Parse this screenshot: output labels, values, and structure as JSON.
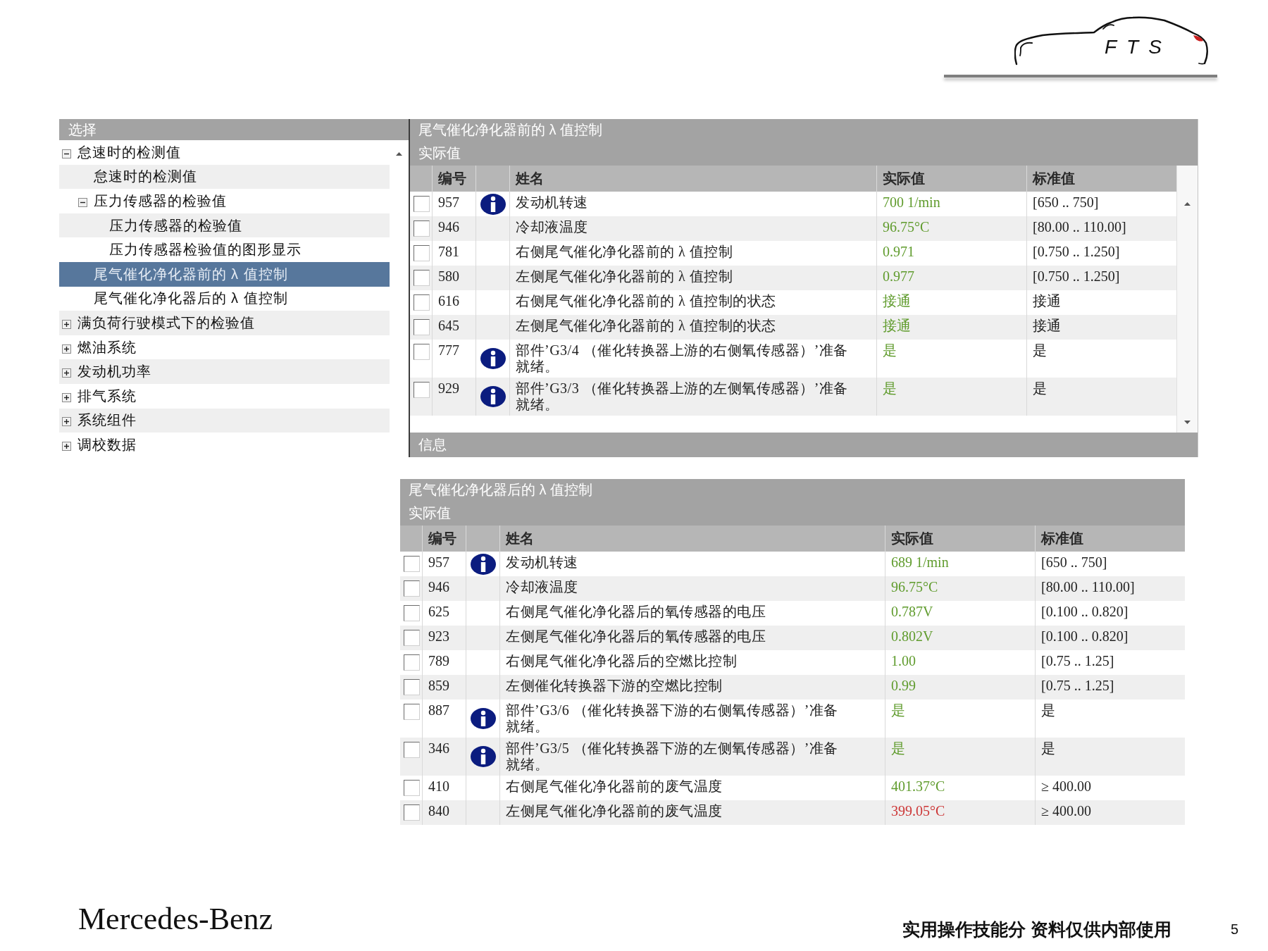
{
  "logo": {
    "text": "FTS"
  },
  "tree": {
    "title": "选择",
    "items": [
      {
        "label": "怠速时的检测值",
        "selected": false,
        "expanded": true,
        "children": [
          {
            "label": "怠速时的检测值",
            "selected": false
          },
          {
            "label": "压力传感器的检验值",
            "selected": false,
            "expanded": true,
            "children": [
              {
                "label": "压力传感器的检验值",
                "selected": false
              },
              {
                "label": "压力传感器检验值的图形显示",
                "selected": false
              }
            ]
          },
          {
            "label": "尾气催化净化器前的 λ 值控制",
            "selected": true
          },
          {
            "label": "尾气催化净化器后的 λ 值控制",
            "selected": false
          }
        ]
      },
      {
        "label": "满负荷行驶模式下的检验值",
        "selected": false,
        "expanded": false
      },
      {
        "label": "燃油系统",
        "selected": false,
        "expanded": false
      },
      {
        "label": "发动机功率",
        "selected": false,
        "expanded": false
      },
      {
        "label": "排气系统",
        "selected": false,
        "expanded": false
      },
      {
        "label": "系统组件",
        "selected": false,
        "expanded": false
      },
      {
        "label": "调校数据",
        "selected": false,
        "expanded": false
      }
    ]
  },
  "panels": [
    {
      "title": "尾气催化净化器前的 λ 值控制",
      "subtitle": "实际值",
      "scrollbar": true,
      "columns": [
        "编号",
        "姓名",
        "实际值",
        "标准值"
      ],
      "rows": [
        {
          "id": "957",
          "checked": false,
          "info": true,
          "name": "发动机转速",
          "actual": "700 1/min",
          "in_spec": true,
          "standard": "[650 .. 750]"
        },
        {
          "id": "946",
          "checked": false,
          "info": false,
          "name": "冷却液温度",
          "actual": "96.75°C",
          "in_spec": true,
          "standard": "[80.00 .. 110.00]"
        },
        {
          "id": "781",
          "checked": false,
          "info": false,
          "name": "右侧尾气催化净化器前的 λ 值控制",
          "actual": "0.971",
          "in_spec": true,
          "standard": "[0.750 .. 1.250]"
        },
        {
          "id": "580",
          "checked": false,
          "info": false,
          "name": "左侧尾气催化净化器前的 λ 值控制",
          "actual": "0.977",
          "in_spec": true,
          "standard": "[0.750 .. 1.250]"
        },
        {
          "id": "616",
          "checked": false,
          "info": false,
          "name": "右侧尾气催化净化器前的 λ 值控制的状态",
          "actual": "接通",
          "in_spec": true,
          "standard": "接通"
        },
        {
          "id": "645",
          "checked": false,
          "info": false,
          "name": "左侧尾气催化净化器前的 λ 值控制的状态",
          "actual": "接通",
          "in_spec": true,
          "standard": "接通"
        },
        {
          "id": "777",
          "checked": false,
          "info": true,
          "name": "部件’G3/4 （催化转换器上游的右侧氧传感器）’准备就绪。",
          "actual": "是",
          "in_spec": true,
          "standard": "是"
        },
        {
          "id": "929",
          "checked": false,
          "info": true,
          "name": "部件’G3/3 （催化转换器上游的左侧氧传感器）’准备就绪。",
          "actual": "是",
          "in_spec": true,
          "standard": "是"
        }
      ],
      "footer": "信息"
    },
    {
      "title": "尾气催化净化器后的 λ 值控制",
      "subtitle": "实际值",
      "scrollbar": false,
      "columns": [
        "编号",
        "姓名",
        "实际值",
        "标准值"
      ],
      "rows": [
        {
          "id": "957",
          "checked": false,
          "info": true,
          "name": "发动机转速",
          "actual": "689 1/min",
          "in_spec": true,
          "standard": "[650 .. 750]"
        },
        {
          "id": "946",
          "checked": false,
          "info": false,
          "name": "冷却液温度",
          "actual": "96.75°C",
          "in_spec": true,
          "standard": "[80.00 .. 110.00]"
        },
        {
          "id": "625",
          "checked": false,
          "info": false,
          "name": "右侧尾气催化净化器后的氧传感器的电压",
          "actual": "0.787V",
          "in_spec": true,
          "standard": "[0.100 .. 0.820]"
        },
        {
          "id": "923",
          "checked": false,
          "info": false,
          "name": "左侧尾气催化净化器后的氧传感器的电压",
          "actual": "0.802V",
          "in_spec": true,
          "standard": "[0.100 .. 0.820]"
        },
        {
          "id": "789",
          "checked": false,
          "info": false,
          "name": "右侧尾气催化净化器后的空燃比控制",
          "actual": "1.00",
          "in_spec": true,
          "standard": "[0.75 .. 1.25]"
        },
        {
          "id": "859",
          "checked": false,
          "info": false,
          "name": "左侧催化转换器下游的空燃比控制",
          "actual": "0.99",
          "in_spec": true,
          "standard": "[0.75 .. 1.25]"
        },
        {
          "id": "887",
          "checked": false,
          "info": true,
          "name": "部件’G3/6 （催化转换器下游的右侧氧传感器）’准备就绪。",
          "actual": "是",
          "in_spec": true,
          "standard": "是"
        },
        {
          "id": "346",
          "checked": false,
          "info": true,
          "name": "部件’G3/5 （催化转换器下游的左侧氧传感器）’准备就绪。",
          "actual": "是",
          "in_spec": true,
          "standard": "是"
        },
        {
          "id": "410",
          "checked": false,
          "info": false,
          "name": "右侧尾气催化净化器前的废气温度",
          "actual": "401.37°C",
          "in_spec": true,
          "standard": "≥ 400.00"
        },
        {
          "id": "840",
          "checked": false,
          "info": false,
          "name": "左侧尾气催化净化器前的废气温度",
          "actual": "399.05°C",
          "in_spec": false,
          "standard": "≥ 400.00"
        }
      ]
    }
  ],
  "footer": {
    "brand": "Mercedes-Benz",
    "note": "实用操作技能分 资料仅供内部使用",
    "page": "5"
  }
}
